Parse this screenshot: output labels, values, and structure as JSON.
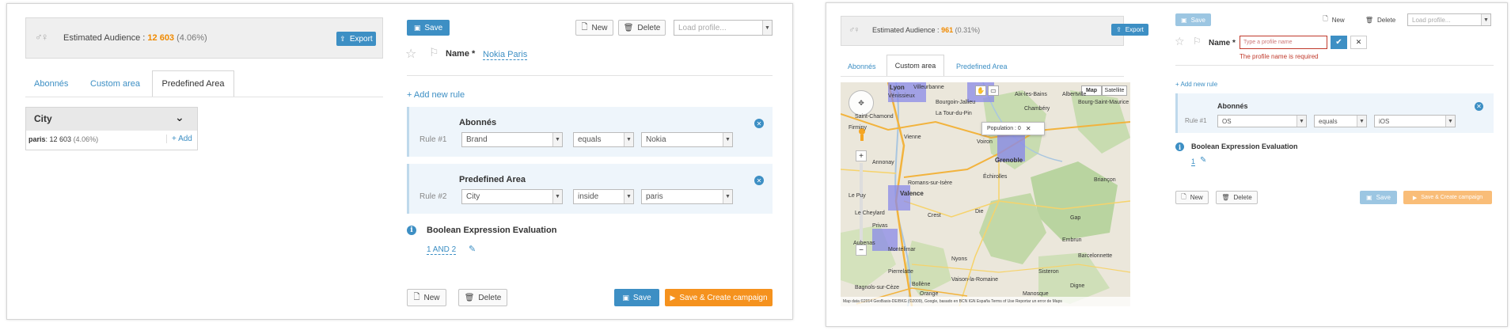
{
  "left": {
    "audience": {
      "label": "Estimated Audience :",
      "count": "12 603",
      "percent": "(4.06%)",
      "export": "Export"
    },
    "tabs": [
      "Abonnés",
      "Custom area",
      "Predefined Area"
    ],
    "city_panel": {
      "title": "City",
      "row_text": "paris",
      "row_count": ": 12 603",
      "row_pct": "(4.06%)",
      "add_label": "Add"
    },
    "toolbar": {
      "save": "Save",
      "new": "New",
      "delete": "Delete",
      "load_profile": "Load profile..."
    },
    "name": {
      "label": "Name *",
      "value": "Nokia Paris"
    },
    "add_new_rule": "Add new rule",
    "rules": [
      {
        "title": "Abonnés",
        "label": "Rule #1",
        "field": "Brand",
        "operator": "equals",
        "value": "Nokia"
      },
      {
        "title": "Predefined Area",
        "label": "Rule #2",
        "field": "City",
        "operator": "inside",
        "value": "paris"
      }
    ],
    "boolean": {
      "title": "Boolean Expression Evaluation",
      "expression": "1 AND 2"
    },
    "bottom": {
      "new": "New",
      "delete": "Delete",
      "save": "Save",
      "save_create": "Save & Create campaign"
    }
  },
  "right": {
    "audience": {
      "label": "Estimated Audience :",
      "count": "961",
      "percent": "(0.31%)",
      "export": "Export"
    },
    "tabs": [
      "Abonnés",
      "Custom area",
      "Predefined Area"
    ],
    "map": {
      "map_btn": "Map",
      "satellite_btn": "Satellite",
      "popup": "Population : 0",
      "zoom_in": "+",
      "zoom_out": "−",
      "footer": "Map data ©2014 GeoBasis-DE/BKG (©2009), Google, basado en BCN IGN España   Terms of Use   Reportar un error de Maps",
      "places": [
        "Lyon",
        "Villeurbanne",
        "Vénissieux",
        "Bourgoin-Jallieu",
        "Chambéry",
        "Albertville",
        "Bourg-Saint-Maurice",
        "Saint-Chamond",
        "La Tour-du-Pin",
        "Aix-les-Bains",
        "Firminy",
        "Vienne",
        "Grenoble",
        "Voiron",
        "Annonay",
        "Romans-sur-Isère",
        "Échirolles",
        "Valence",
        "Le Cheylard",
        "Privas",
        "Crest",
        "Die",
        "Gap",
        "Aubenas",
        "Montélimar",
        "Nyons",
        "Pierrelatte",
        "Bollène",
        "Orange",
        "Sisteron",
        "Digne",
        "Briançon",
        "Vaison-la-Romaine",
        "Barcelonnette",
        "Manosque",
        "Bagnols-sur-Cèze",
        "Embrun",
        "Le Puy"
      ]
    },
    "toolbar": {
      "save": "Save",
      "new": "New",
      "delete": "Delete",
      "load_profile": "Load profile..."
    },
    "name": {
      "label": "Name *",
      "placeholder": "Type a profile name",
      "error": "The profile name is required"
    },
    "add_new_rule": "Add new rule",
    "rule": {
      "title": "Abonnés",
      "label": "Rule #1",
      "field": "OS",
      "operator": "equals",
      "value": "iOS"
    },
    "boolean": {
      "title": "Boolean Expression Evaluation",
      "expression": "1"
    },
    "bottom": {
      "new": "New",
      "delete": "Delete",
      "save": "Save",
      "save_create": "Save & Create campaign"
    }
  },
  "colors": {
    "accent": "#3d8fc4",
    "orange": "#f5921e",
    "count": "#f08a00",
    "rule_bg": "#eef5fb",
    "map_area": "#8a8ae8"
  }
}
